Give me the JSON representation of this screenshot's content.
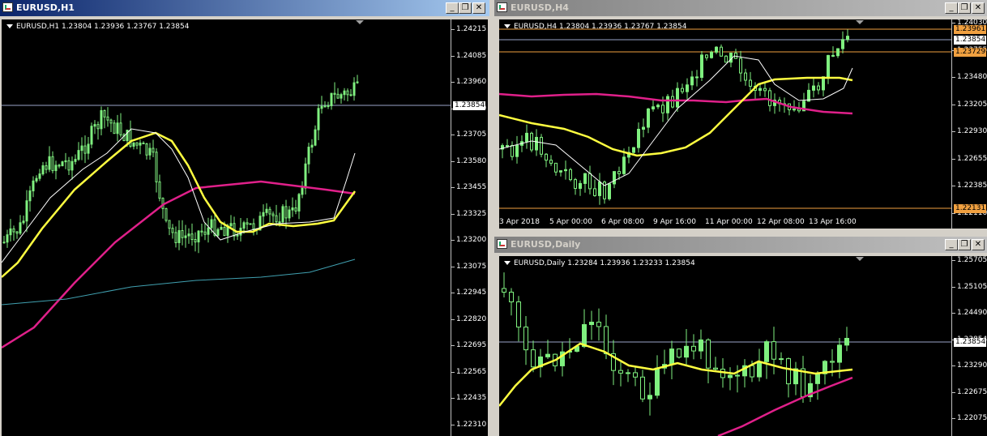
{
  "windows": {
    "h1": {
      "title": "EURUSD,H1",
      "info": "EURUSD,H1  1.23804 1.23936 1.23767 1.23854",
      "price_labels": [
        "1.24215",
        "1.24085",
        "1.23960",
        "1.23830",
        "1.23705",
        "1.23580",
        "1.23455",
        "1.23325",
        "1.23200",
        "1.23075",
        "1.22945",
        "1.22820",
        "1.22695",
        "1.22565",
        "1.22435",
        "1.22310"
      ],
      "current_price": "1.23854"
    },
    "h4": {
      "title": "EURUSD,H4",
      "info": "EURUSD,H4  1.23804 1.23936 1.23767 1.23854",
      "price_labels": [
        "1.24030",
        "1.23755",
        "1.23480",
        "1.23205",
        "1.22930",
        "1.22655",
        "1.22385",
        "1.22110"
      ],
      "boxed_prices": {
        "upper": "1.23961",
        "current": "1.23854",
        "middle": "1.23729",
        "lower": "1.22131"
      },
      "time_labels": [
        "3 Apr 2018",
        "5 Apr 00:00",
        "6 Apr 08:00",
        "9 Apr 16:00",
        "11 Apr 00:00",
        "12 Apr 08:00",
        "13 Apr 16:00"
      ]
    },
    "daily": {
      "title": "EURUSD,Daily",
      "info": "EURUSD,Daily  1.23284 1.23936 1.23233 1.23854",
      "price_labels": [
        "1.25705",
        "1.25105",
        "1.24490",
        "1.23854",
        "1.23290",
        "1.22675",
        "1.22075"
      ],
      "current_price": "1.23854"
    }
  },
  "buttons": {
    "minimize": "_",
    "restore": "❐",
    "close": "✕"
  },
  "colors": {
    "bull_candle": "#7ff07f",
    "bear_candle": "#000000",
    "wick": "#7ff07f",
    "ma_fast": "#ffffff",
    "ma_mid": "#ffff40",
    "ma_slow": "#e0208a",
    "ma_very_slow": "#40a0b0",
    "price_line": "#9aa4c8",
    "level_line": "#f0a040",
    "active_title": "#0a246a"
  }
}
